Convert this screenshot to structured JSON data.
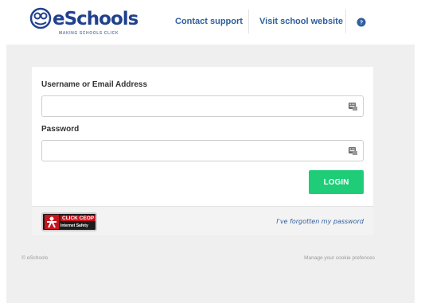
{
  "header": {
    "logo_text": "eSchools",
    "logo_tagline": "MAKING SCHOOLS CLICK",
    "nav": {
      "contact_support": "Contact support",
      "visit_school_website": "Visit school website"
    },
    "help_icon": "help-circle-icon"
  },
  "login_form": {
    "username_label": "Username or Email Address",
    "username_value": "",
    "password_label": "Password",
    "password_value": "",
    "field_icon": "virtual-keyboard-icon",
    "login_button": "LOGIN"
  },
  "card_footer": {
    "ceop_line1": "CLICK CEOP",
    "ceop_line2": "Internet Safety",
    "forgot_password": "I've forgotten my password"
  },
  "page_footer": {
    "copyright": "© eSchools",
    "cookie_link": "Manage your cookie prefences"
  },
  "colors": {
    "brand_blue": "#21418e",
    "link_blue": "#2f5f9e",
    "login_green": "#1fcc77",
    "page_grey": "#efefef",
    "ceop_red": "#c9141d"
  }
}
